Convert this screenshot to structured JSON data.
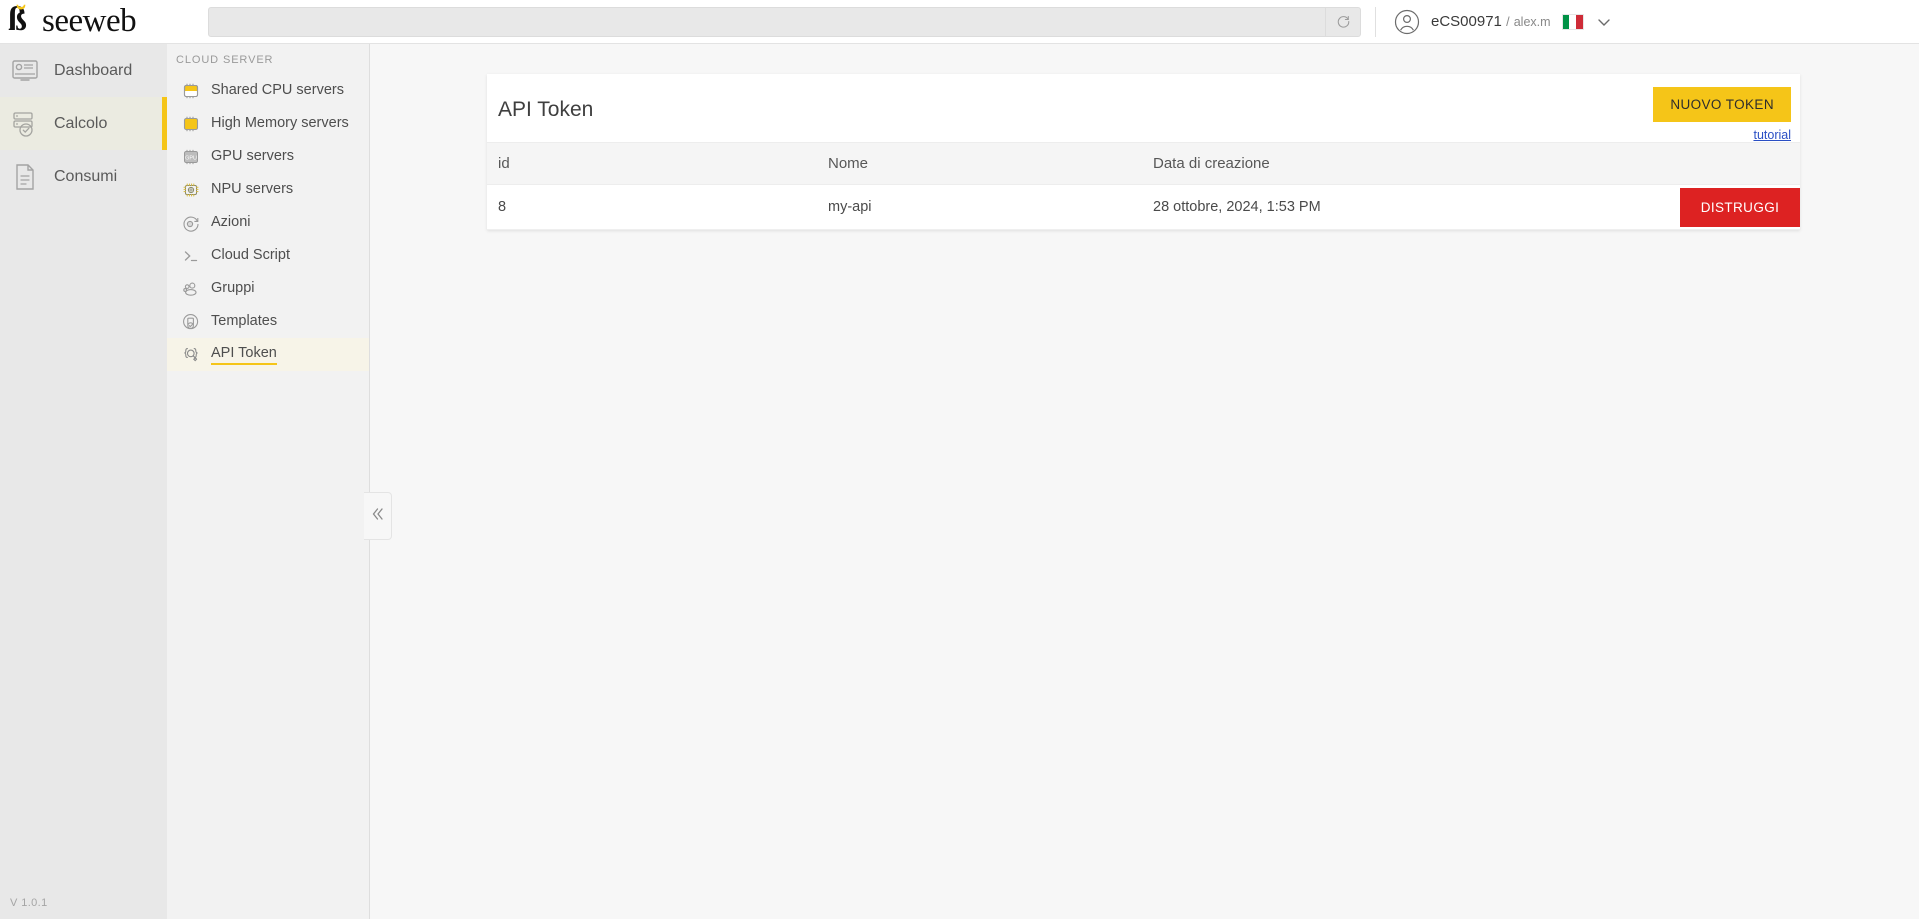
{
  "brand": {
    "name": "seeweb"
  },
  "topbar": {
    "search": {
      "value": "",
      "placeholder": ""
    },
    "refresh_icon": "refresh-icon",
    "user": {
      "avatar_icon": "avatar-icon",
      "account": "eCS00971",
      "separator": "/",
      "username": "alex.m",
      "flag": "italy-flag-icon",
      "chevron_icon": "chevron-down-icon"
    }
  },
  "rail": {
    "items": [
      {
        "label": "Dashboard",
        "icon": "dashboard-icon",
        "active": false
      },
      {
        "label": "Calcolo",
        "icon": "server-check-icon",
        "active": true
      },
      {
        "label": "Consumi",
        "icon": "document-icon",
        "active": false
      }
    ],
    "version": "V 1.0.1"
  },
  "subnav": {
    "title": "CLOUD SERVER",
    "items": [
      {
        "label": "Shared CPU servers",
        "icon": "cpu-chip-icon",
        "active": false
      },
      {
        "label": "High Memory servers",
        "icon": "memory-chip-icon",
        "active": false
      },
      {
        "label": "GPU servers",
        "icon": "gpu-chip-icon",
        "active": false
      },
      {
        "label": "NPU servers",
        "icon": "npu-chip-icon",
        "active": false
      },
      {
        "label": "Azioni",
        "icon": "actions-gear-icon",
        "active": false
      },
      {
        "label": "Cloud Script",
        "icon": "terminal-icon",
        "active": false
      },
      {
        "label": "Gruppi",
        "icon": "users-group-icon",
        "active": false
      },
      {
        "label": "Templates",
        "icon": "templates-icon",
        "active": false
      },
      {
        "label": "API Token",
        "icon": "api-token-icon",
        "active": true
      }
    ],
    "collapse_icon": "double-chevron-left-icon"
  },
  "main": {
    "card": {
      "title": "API Token",
      "new_token_button": "NUOVO TOKEN",
      "tutorial_link": "tutorial",
      "table": {
        "columns": [
          "id",
          "Nome",
          "Data di creazione",
          ""
        ],
        "rows": [
          {
            "id": "8",
            "nome": "my-api",
            "data": "28 ottobre, 2024, 1:53 PM",
            "action": "DISTRUGGI"
          }
        ]
      }
    }
  },
  "colors": {
    "accent_yellow": "#f5c518",
    "danger_red": "#dd2222",
    "link_blue": "#2a4fc4"
  }
}
